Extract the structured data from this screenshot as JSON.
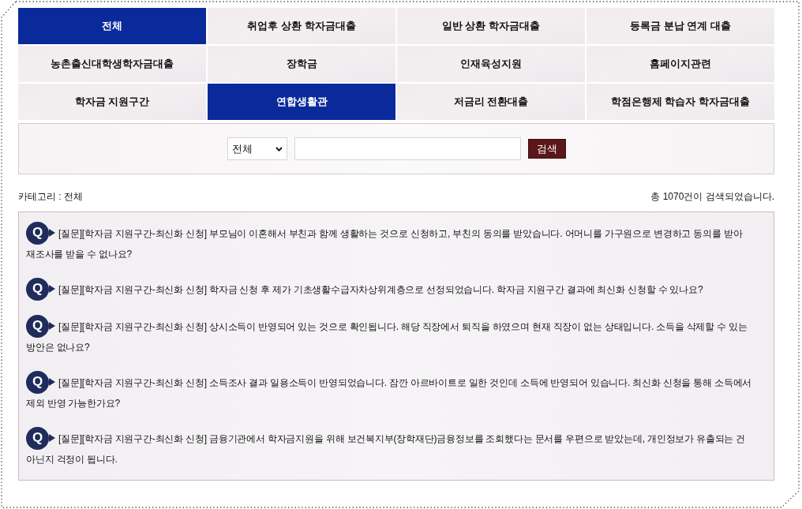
{
  "tabs": [
    {
      "label": "전체",
      "selected": true
    },
    {
      "label": "취업후 상환 학자금대출",
      "selected": false
    },
    {
      "label": "일반 상환 학자금대출",
      "selected": false
    },
    {
      "label": "등록금 분납 연계 대출",
      "selected": false
    },
    {
      "label": "농촌출신대학생학자금대출",
      "selected": false
    },
    {
      "label": "장학금",
      "selected": false
    },
    {
      "label": "인재육성지원",
      "selected": false
    },
    {
      "label": "홈페이지관련",
      "selected": false
    },
    {
      "label": "학자금 지원구간",
      "selected": false
    },
    {
      "label": "연합생활관",
      "selected": true
    },
    {
      "label": "저금리 전환대출",
      "selected": false
    },
    {
      "label": "학점은행제 학습자 학자금대출",
      "selected": false
    }
  ],
  "search": {
    "scope": "전체",
    "button": "검색"
  },
  "summary": {
    "category": "카테고리 : 전체",
    "result_count": "총 1070건이 검색되었습니다."
  },
  "questions": [
    {
      "badge": "Q",
      "text": "[질문][학자금 지원구간-최신화 신청] 부모님이 이혼해서 부친과 함께 생활하는 것으로 신청하고, 부친의 동의를 받았습니다. 어머니를 가구원으로 변경하고 동의를 받아 재조사를 받을 수 없나요?"
    },
    {
      "badge": "Q",
      "text": "[질문][학자금 지원구간-최신화 신청] 학자금 신청 후 제가 기초생활수급자차상위계층으로 선정되었습니다. 학자금 지원구간 결과에 최신화 신청할 수 있나요?"
    },
    {
      "badge": "Q",
      "text": "[질문][학자금 지원구간-최신화 신청] 상시소득이 반영되어 있는 것으로 확인됩니다. 해당 직장에서 퇴직을 하였으며 현재 직장이 없는 상태입니다. 소득을 삭제할 수 있는 방안은 없나요?"
    },
    {
      "badge": "Q",
      "text": "[질문][학자금 지원구간-최신화 신청] 소득조사 결과 일용소득이 반영되었습니다. 잠깐 아르바이트로 일한 것인데 소득에 반영되어 있습니다. 최신화 신청을 통해 소득에서 제외 반영 가능한가요?"
    },
    {
      "badge": "Q",
      "text": "[질문][학자금 지원구간-최신화 신청] 금융기관에서 학자금지원을 위해 보건복지부(장학재단)금융정보를 조회했다는 문서를 우편으로 받았는데, 개인정보가 유출되는 건 아닌지 걱정이 됩니다."
    }
  ]
}
